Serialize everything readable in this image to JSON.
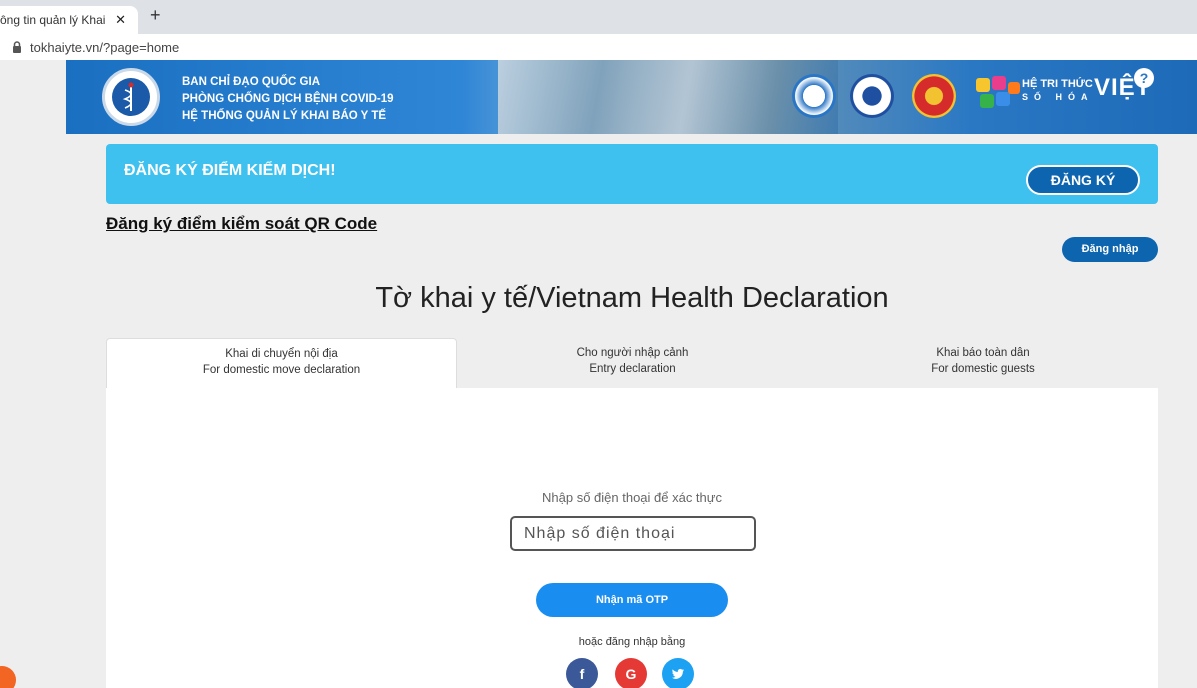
{
  "browser": {
    "tab_title": "ông tin quản lý Khai",
    "tab_close": "✕",
    "new_tab": "+",
    "url": "tokhaiyte.vn/?page=home"
  },
  "header": {
    "line1": "BAN CHỈ ĐẠO QUỐC GIA",
    "line2": "PHÒNG CHỐNG DỊCH BỆNH COVID-19",
    "line3": "HỆ THỐNG QUẢN LÝ KHAI BÁO Y TẾ",
    "brand_line1": "HỆ TRI THỨC",
    "brand_viet": "VIỆT",
    "brand_sohoa": "SỐ HÓA",
    "help": "?"
  },
  "registration": {
    "title": "ĐĂNG KÝ ĐIỂM KIỂM DỊCH!",
    "button": "ĐĂNG KÝ"
  },
  "qr_link": "Đăng ký điểm kiểm soát QR Code",
  "login_button": "Đăng nhập",
  "page_title": "Tờ khai y tế/Vietnam Health Declaration",
  "tabs": [
    {
      "line1": "Khai di chuyển nội địa",
      "line2": "For domestic move declaration",
      "active": true
    },
    {
      "line1": "Cho người nhập cảnh",
      "line2": "Entry declaration",
      "active": false
    },
    {
      "line1": "Khai báo toàn dân",
      "line2": "For domestic guests",
      "active": false
    }
  ],
  "form": {
    "verify_label": "Nhập số điện thoại để xác thực",
    "phone_placeholder": "Nhập số điện thoại",
    "otp_button": "Nhận mã OTP",
    "or_label": "hoặc đăng nhập bằng"
  },
  "social": {
    "facebook": "f",
    "google": "G",
    "twitter": "t"
  },
  "colors": {
    "banner_blue": "#1a6fc1",
    "reg_bar": "#3fc1f0",
    "primary": "#0d65b0",
    "otp": "#1a8ef0"
  }
}
